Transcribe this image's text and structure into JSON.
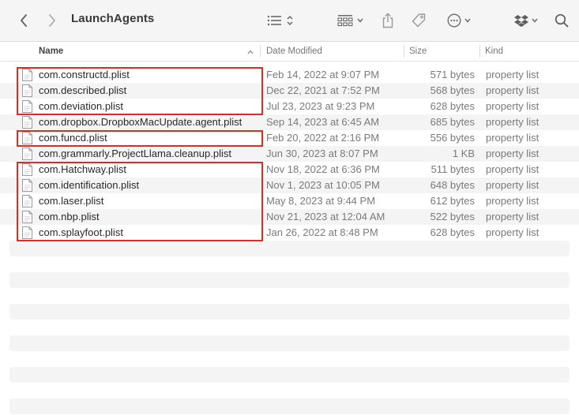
{
  "toolbar": {
    "title": "LaunchAgents"
  },
  "columns": {
    "name": "Name",
    "date": "Date Modified",
    "size": "Size",
    "kind": "Kind"
  },
  "files": [
    {
      "name": "com.constructd.plist",
      "date": "Feb 14, 2022 at 9:07 PM",
      "size": "571 bytes",
      "kind": "property list"
    },
    {
      "name": "com.described.plist",
      "date": "Dec 22, 2021 at 7:52 PM",
      "size": "568 bytes",
      "kind": "property list"
    },
    {
      "name": "com.deviation.plist",
      "date": "Jul 23, 2023 at 9:23 PM",
      "size": "628 bytes",
      "kind": "property list"
    },
    {
      "name": "com.dropbox.DropboxMacUpdate.agent.plist",
      "date": "Sep 14, 2023 at 6:45 AM",
      "size": "685 bytes",
      "kind": "property list"
    },
    {
      "name": "com.funcd.plist",
      "date": "Feb 20, 2022 at 2:16 PM",
      "size": "556 bytes",
      "kind": "property list"
    },
    {
      "name": "com.grammarly.ProjectLlama.cleanup.plist",
      "date": "Jun 30, 2023 at 8:07 PM",
      "size": "1 KB",
      "kind": "property list"
    },
    {
      "name": "com.Hatchway.plist",
      "date": "Nov 18, 2022 at 6:36 PM",
      "size": "511 bytes",
      "kind": "property list"
    },
    {
      "name": "com.identification.plist",
      "date": "Nov 1, 2023 at 10:05 PM",
      "size": "648 bytes",
      "kind": "property list"
    },
    {
      "name": "com.laser.plist",
      "date": "May 8, 2023 at 9:44 PM",
      "size": "612 bytes",
      "kind": "property list"
    },
    {
      "name": "com.nbp.plist",
      "date": "Nov 21, 2023 at 12:04 AM",
      "size": "522 bytes",
      "kind": "property list"
    },
    {
      "name": "com.splayfoot.plist",
      "date": "Jan 26, 2022 at 8:48 PM",
      "size": "628 bytes",
      "kind": "property list"
    }
  ],
  "colors": {
    "highlight": "#e02b20",
    "stripe": "#f4f4f5",
    "toolbar_bg": "#f6f5f6"
  },
  "icons": [
    "back-chevron-icon",
    "forward-chevron-icon",
    "list-view-icon",
    "sort-updown-icon",
    "grid-view-icon",
    "chevron-down-icon",
    "share-icon",
    "tag-icon",
    "more-icon",
    "dropbox-icon",
    "search-icon",
    "sort-up-icon",
    "document-icon"
  ]
}
